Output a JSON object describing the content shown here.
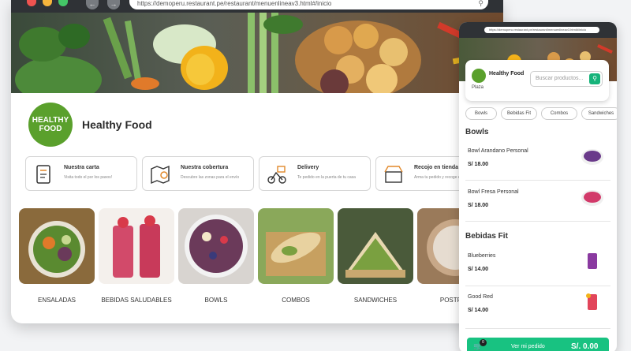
{
  "browser": {
    "url": "https://demoperu.restaurant.pe/restaurant/menuenlineav3.html#/inicio",
    "traffic_lights": {
      "close": "#ef5350",
      "minimize": "#f6b53c",
      "maximize": "#44c767"
    }
  },
  "brand": {
    "name": "Healthy Food",
    "logo_text": "HEALTHY FOOD",
    "accent": "#5aa02c"
  },
  "info_cards": [
    {
      "title": "Nuestra carta",
      "desc": "Visita todo el por los pasos!",
      "icon": "menu-icon"
    },
    {
      "title": "Nuestra cobertura",
      "desc": "Descubre las zonas para el envío",
      "icon": "map-pin-icon"
    },
    {
      "title": "Delivery",
      "desc": "Te pedido en la puerta de tu casa",
      "icon": "delivery-icon"
    },
    {
      "title": "Recojo en tienda",
      "desc": "Arma tu pedido y recoge en tienda.",
      "icon": "store-pickup-icon"
    }
  ],
  "categories": [
    {
      "label": "ENSALADAS",
      "color": "#8a6a3c"
    },
    {
      "label": "BEBIDAS SALUDABLES",
      "color": "#d24a6a"
    },
    {
      "label": "BOWLS",
      "color": "#6b3a5a"
    },
    {
      "label": "COMBOS",
      "color": "#c7a060"
    },
    {
      "label": "SANDWICHES",
      "color": "#6a7a4a"
    },
    {
      "label": "POSTRES",
      "color": "#9a7a5a"
    }
  ],
  "mobile": {
    "url": "https://demoperu.restaurant.pe/restaurant/menuenlineav3.html#/inicio",
    "brand_name": "Healthy Food",
    "location": "Plaza",
    "search_placeholder": "Buscar productos...",
    "tabs": [
      "Bowls",
      "Bebidas Fit",
      "Combos",
      "Sandwiches"
    ],
    "sections": [
      {
        "title": "Bowls",
        "items": [
          {
            "name": "Bowl Arandano Personal",
            "price": "S/ 18.00",
            "thumb": "#6a3a8a"
          },
          {
            "name": "Bowl Fresa Personal",
            "price": "S/ 18.00",
            "thumb": "#d23a6a"
          }
        ]
      },
      {
        "title": "Bebidas Fit",
        "items": [
          {
            "name": "Blueberries",
            "price": "S/ 14.00",
            "thumb": "#8a3aa0"
          },
          {
            "name": "Good Red",
            "price": "S/ 14.00",
            "thumb": "#e2455a"
          }
        ]
      }
    ],
    "cart": {
      "count": "0",
      "label": "Ver mi pedido",
      "total": "S/. 0.00",
      "color": "#18c281"
    }
  }
}
